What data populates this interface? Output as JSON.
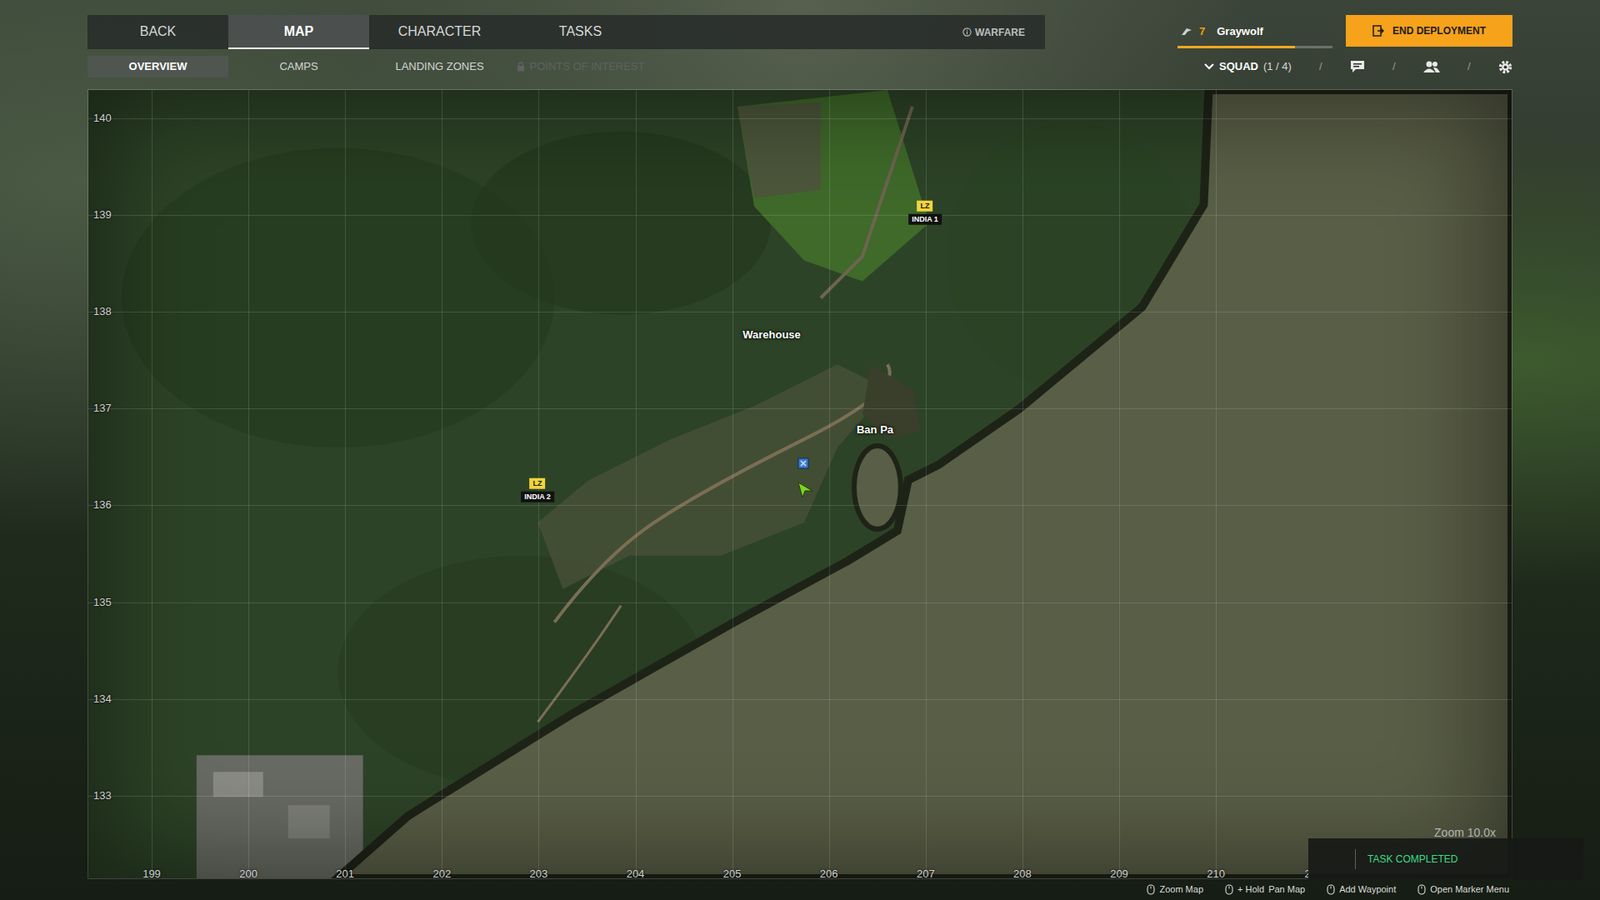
{
  "top_tabs": [
    {
      "label": "BACK",
      "selected": false
    },
    {
      "label": "MAP",
      "selected": true
    },
    {
      "label": "CHARACTER",
      "selected": false
    },
    {
      "label": "TASKS",
      "selected": false
    }
  ],
  "mode": {
    "label": "WARFARE"
  },
  "player": {
    "rank": "7",
    "name": "Graywolf",
    "level": 0.76
  },
  "end_button": {
    "label": "END DEPLOYMENT"
  },
  "sub_tabs": [
    {
      "label": "OVERVIEW",
      "selected": true,
      "disabled": false
    },
    {
      "label": "CAMPS",
      "selected": false,
      "disabled": false
    },
    {
      "label": "LANDING ZONES",
      "selected": false,
      "disabled": false
    },
    {
      "label": "POINTS OF INTEREST",
      "selected": false,
      "disabled": true
    }
  ],
  "squad": {
    "label": "SQUAD",
    "count": "(1 / 4)",
    "expanded": false
  },
  "toolbar_separators": [
    "/",
    "/",
    "/"
  ],
  "map": {
    "grid_x": [
      "199",
      "200",
      "201",
      "202",
      "203",
      "204",
      "205",
      "206",
      "207",
      "208",
      "209",
      "210",
      "2"
    ],
    "grid_y": [
      "140",
      "139",
      "138",
      "137",
      "136",
      "135",
      "134",
      "133"
    ],
    "places": [
      {
        "label": "Warehouse"
      },
      {
        "label": "Ban Pa"
      }
    ],
    "landing_zones": [
      {
        "tag": "LZ",
        "name": "INDIA 1"
      },
      {
        "tag": "LZ",
        "name": "INDIA 2"
      }
    ],
    "zoom": "Zoom 10.0x"
  },
  "toast": {
    "text": "TASK COMPLETED"
  },
  "hints": [
    {
      "action": "Zoom Map"
    },
    {
      "modifier": "+ Hold",
      "action": "Pan Map"
    },
    {
      "action": "Add Waypoint"
    },
    {
      "action": "Open Marker Menu"
    }
  ]
}
